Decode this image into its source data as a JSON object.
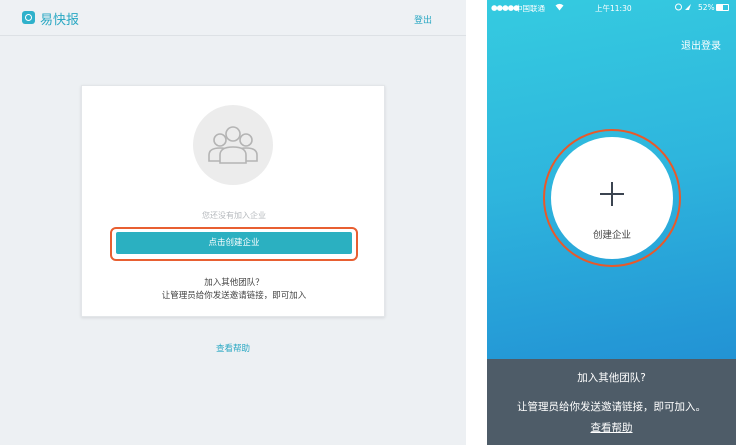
{
  "web": {
    "brand": "易快报",
    "logout": "登出",
    "empty_text": "您还没有加入企业",
    "create_button": "点击创建企业",
    "join_question": "加入其他团队？",
    "join_tip": "让管理员给你发送邀请链接，即可加入",
    "help_link": "查看帮助"
  },
  "mobile": {
    "status": {
      "signal": "●●●●●",
      "carrier": "中国联通",
      "time": "上午11:30",
      "battery": "52%"
    },
    "logout": "退出登录",
    "create_label": "创建企业",
    "join_question": "加入其他团队?",
    "join_tip": "让管理员给你发送邀请链接，即可加入。",
    "help_link": "查看帮助"
  },
  "colors": {
    "accent": "#2bb0c1",
    "highlight_ring": "#e85f31",
    "mobile_footer": "#4e5c68"
  },
  "icons": [
    "logo-icon",
    "team-avatar-icon",
    "wifi-icon",
    "battery-icon",
    "plus-icon"
  ]
}
